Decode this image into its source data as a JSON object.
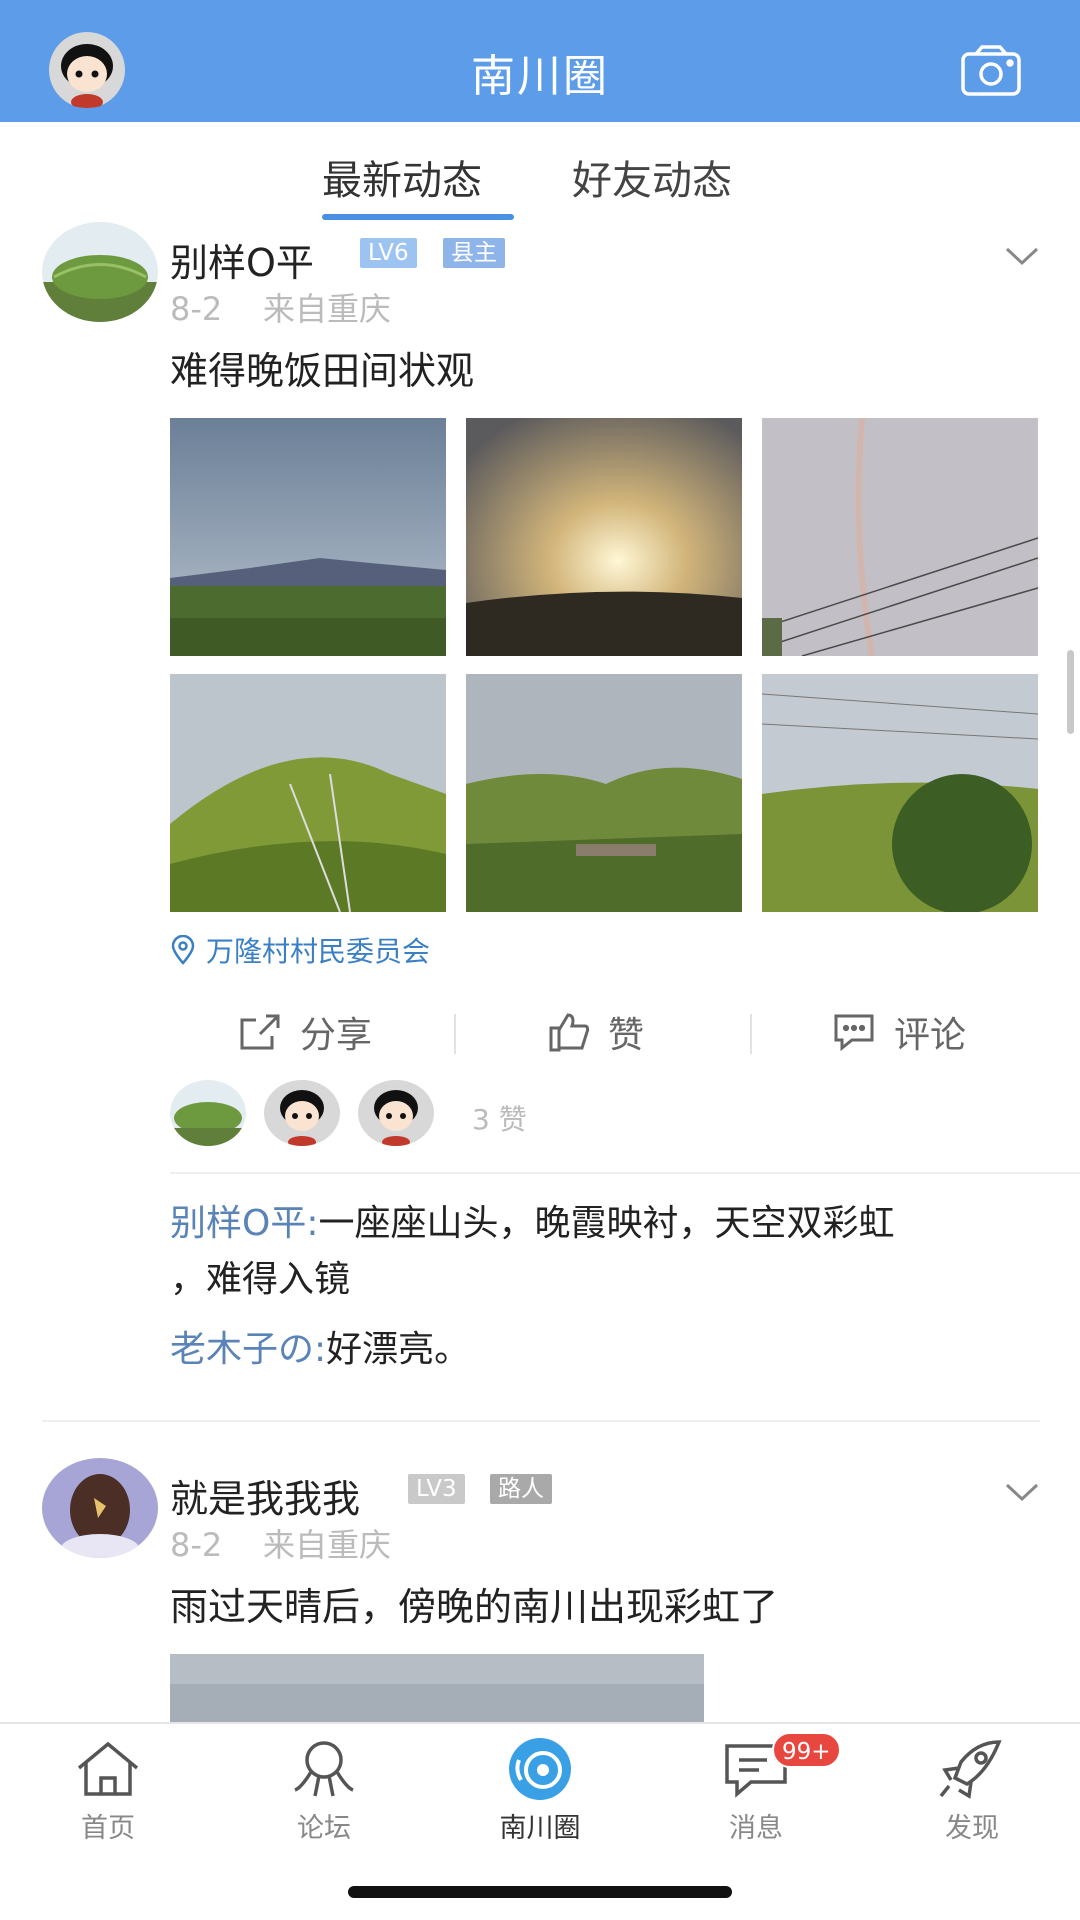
{
  "header": {
    "title": "南川圈",
    "camera_icon": "camera-icon",
    "avatar_icon": "cartoon-avatar"
  },
  "tabs": [
    {
      "label": "最新动态",
      "active": true
    },
    {
      "label": "好友动态",
      "active": false
    }
  ],
  "posts": [
    {
      "author": "别样O平",
      "level": "LV6",
      "title_badge": "县主",
      "date": "8-2",
      "from": "来自重庆",
      "text": "难得晚饭田间状观",
      "location": "万隆村村民委员会",
      "actions": {
        "share": "分享",
        "like": "赞",
        "comment": "评论"
      },
      "like_count": "3 赞",
      "comments": [
        {
          "name": "别样O平:",
          "text": "一座座山头，晚霞映衬，天空双彩虹",
          "text_line2": "，难得入镜"
        },
        {
          "name": "老木子の:",
          "text": "好漂亮。"
        }
      ]
    },
    {
      "author": "就是我我我",
      "level": "LV3",
      "title_badge": "路人",
      "date": "8-2",
      "from": "来自重庆",
      "text": "雨过天晴后，傍晚的南川出现彩虹了"
    }
  ],
  "bottom_nav": [
    {
      "label": "首页",
      "icon": "home-icon"
    },
    {
      "label": "论坛",
      "icon": "forum-icon"
    },
    {
      "label": "南川圈",
      "icon": "circle-icon",
      "active": true
    },
    {
      "label": "消息",
      "icon": "message-icon",
      "badge": "99+"
    },
    {
      "label": "发现",
      "icon": "rocket-icon"
    }
  ],
  "colors": {
    "header_bg": "#5c9ce9",
    "accent": "#4a90e2",
    "comment_name": "#5a83b8",
    "badge_red": "#e8473f"
  }
}
